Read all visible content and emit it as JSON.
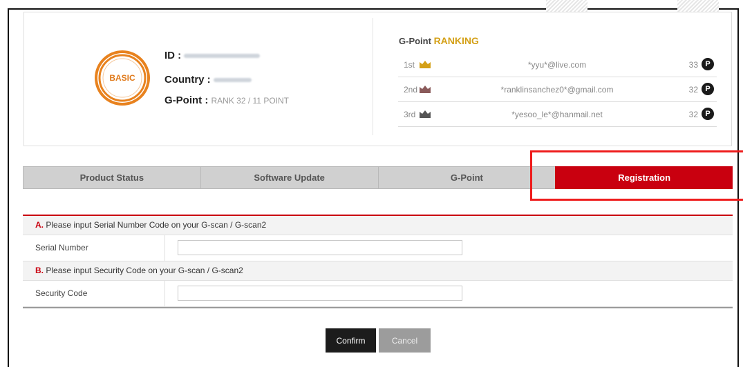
{
  "profile": {
    "badge_label": "BASIC",
    "id_label": "ID :",
    "country_label": "Country :",
    "gpoint_label": "G-Point :",
    "gpoint_value": "RANK 32 / 11 POINT"
  },
  "ranking": {
    "title_prefix": "G-Point",
    "title_accent": "RANKING",
    "rows": [
      {
        "pos": "1st",
        "email": "*yyu*@live.com",
        "points": "33",
        "crown_color": "#d4a017"
      },
      {
        "pos": "2nd",
        "email": "*ranklinsanchez0*@gmail.com",
        "points": "32",
        "crown_color": "#8a5a5a"
      },
      {
        "pos": "3rd",
        "email": "*yesoo_le*@hanmail.net",
        "points": "32",
        "crown_color": "#555555"
      }
    ],
    "point_icon": "P"
  },
  "tabs": [
    {
      "label": "Product Status",
      "active": false
    },
    {
      "label": "Software Update",
      "active": false
    },
    {
      "label": "G-Point",
      "active": false
    },
    {
      "label": "Registration",
      "active": true
    }
  ],
  "form": {
    "section_a": {
      "letter": "A.",
      "text": "Please input Serial Number Code on your G-scan / G-scan2"
    },
    "serial_label": "Serial Number",
    "serial_value": "",
    "section_b": {
      "letter": "B.",
      "text": "Please input Security Code on your G-scan / G-scan2"
    },
    "security_label": "Security Code",
    "security_value": ""
  },
  "buttons": {
    "confirm": "Confirm",
    "cancel": "Cancel"
  },
  "colors": {
    "accent_red": "#c9000f",
    "gold": "#d4a017",
    "badge_orange": "#e07a1b"
  }
}
